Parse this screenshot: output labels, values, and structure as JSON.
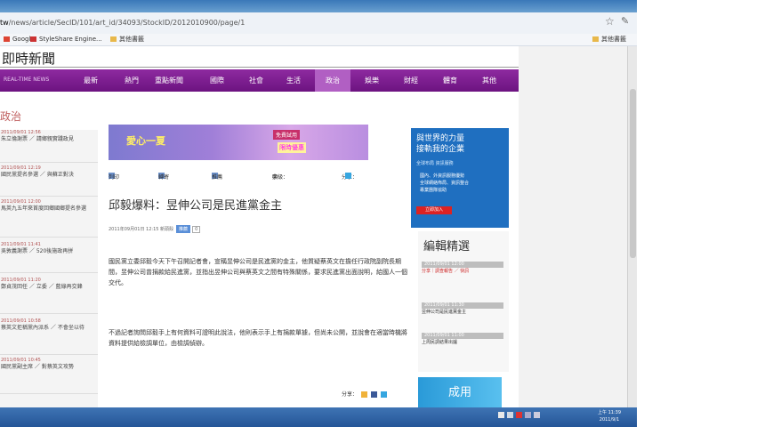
{
  "browser": {
    "url_host": "tw",
    "url_path": "/news/article/SecID/101/art_id/34093/StockID/2012010900/page/1",
    "bookmarks": [
      {
        "label": "Google"
      },
      {
        "label": "StyleShare Engine..."
      },
      {
        "label": "其他書籤"
      }
    ],
    "bookmarks_right": "其他書籤"
  },
  "site": {
    "title": "即時新聞",
    "nav_subtitle": "REAL-TIME NEWS",
    "nav": [
      {
        "label": "最新"
      },
      {
        "label": "熱門"
      },
      {
        "label": "重點新聞"
      },
      {
        "label": "國際"
      },
      {
        "label": "社會"
      },
      {
        "label": "生活"
      },
      {
        "label": "政治"
      },
      {
        "label": "娛樂"
      },
      {
        "label": "財經"
      },
      {
        "label": "體育"
      },
      {
        "label": "其他"
      }
    ],
    "active_nav": "政治"
  },
  "section": {
    "title": "政治",
    "items": [
      {
        "date": "2011/09/01 12:56",
        "text": "朱立倫謝票 ／ 請鄉親實踐政見"
      },
      {
        "date": "2011/09/01 12:19",
        "text": "國民黨提名參選 ／ 與蘇正對決"
      },
      {
        "date": "2011/09/01 12:00",
        "text": "馬英九五年來首度回鄉國鄉提名參選"
      },
      {
        "date": "2011/09/01 11:41",
        "text": "吳敦義謝票 ／ 520後施政再拼"
      },
      {
        "date": "2011/09/01 11:20",
        "text": "鄭貞茂回任 ／ 立委 ／ 藍綠再交鋒"
      },
      {
        "date": "2011/09/01 10:58",
        "text": "蔡英文拒稱黨內派系 ／ 不會坐以待"
      },
      {
        "date": "2011/09/01 10:45",
        "text": "國民黨副主席 ／ 對蔡英文攻勢"
      }
    ]
  },
  "banner": {
    "headline": "愛心一夏",
    "tag": "免費試用",
    "sub": "限時優惠"
  },
  "tools": {
    "print": "列印",
    "email": "轉寄",
    "recommend": "推薦",
    "font_label": "字級：",
    "font_sizes": [
      "大",
      "中",
      "小"
    ],
    "share": "分享："
  },
  "article": {
    "headline": "邱毅爆料：昱伸公司是民進黨金主",
    "meta": "2011年09月01日 12:15 新頭殼",
    "meta_btn": "推薦",
    "meta_btn2": "0",
    "paragraphs": [
      "國民黨立委邱毅今天下午召開記者會，宣稱昱伸公司是民進黨的金主，他質疑蔡英文在擔任行政院副院長期間，昱伸公司曾捐款給民進黨，並指出昱伸公司與蔡英文之間有特殊關係，要求民進黨出面說明，給國人一個交代。",
      "不過記者詢問邱毅手上有何資料可證明此說法，他則表示手上有捐款單據，但尚未公開，並說會在適當時機將資料提供給檢調單位，由檢調偵辦。"
    ],
    "share_bottom": "分享："
  },
  "ad": {
    "title": "與世界的力量\n接軌我的企業",
    "sub": "全球布局 資訊服務",
    "bullets": [
      "國內、外資訊服務優勢",
      "全球網絡佈局、資訊整合",
      "專業團隊協助"
    ],
    "button": "立即加入"
  },
  "editors": {
    "title": "編輯精選",
    "rows": [
      {
        "head": "2011/09/01 12:00",
        "text": "分享｜調查報告 ／ 快訊"
      },
      {
        "head": "2011/09/01 11:30",
        "text": "昱伸公司是民進黨金主"
      },
      {
        "head": "2011/09/01 11:00",
        "text": "上周民調結果出爐"
      }
    ]
  },
  "ad2": {
    "text": "成用"
  },
  "taskbar": {
    "time": "上午 11:39",
    "date": "2011/9/1"
  }
}
